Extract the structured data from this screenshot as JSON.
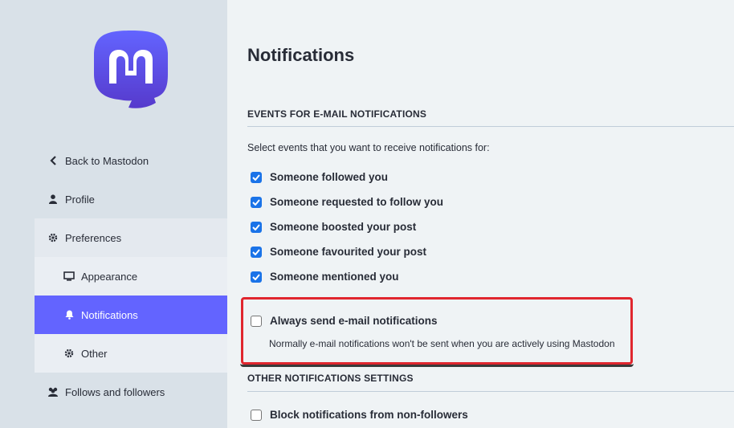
{
  "sidebar": {
    "logo": "mastodon-logo",
    "items": [
      {
        "label": "Back to Mastodon",
        "icon": "chevron-left-icon"
      },
      {
        "label": "Profile",
        "icon": "user-icon"
      },
      {
        "label": "Preferences",
        "icon": "gear-icon"
      },
      {
        "label": "Appearance",
        "icon": "desktop-icon"
      },
      {
        "label": "Notifications",
        "icon": "bell-icon",
        "active": true
      },
      {
        "label": "Other",
        "icon": "gear-icon"
      },
      {
        "label": "Follows and followers",
        "icon": "users-icon"
      }
    ]
  },
  "main": {
    "title": "Notifications",
    "email_section": {
      "heading": "EVENTS FOR E-MAIL NOTIFICATIONS",
      "hint": "Select events that you want to receive notifications for:",
      "options": [
        {
          "label": "Someone followed you",
          "checked": true
        },
        {
          "label": "Someone requested to follow you",
          "checked": true
        },
        {
          "label": "Someone boosted your post",
          "checked": true
        },
        {
          "label": "Someone favourited your post",
          "checked": true
        },
        {
          "label": "Someone mentioned you",
          "checked": true
        }
      ],
      "always_send": {
        "label": "Always send e-mail notifications",
        "checked": false,
        "description": "Normally e-mail notifications won't be sent when you are actively using Mastodon"
      }
    },
    "other_section": {
      "heading": "OTHER NOTIFICATIONS SETTINGS",
      "options": [
        {
          "label": "Block notifications from non-followers",
          "checked": false
        }
      ]
    }
  },
  "colors": {
    "accent": "#6364ff",
    "checkbox": "#1a73e8",
    "highlight": "#e0262e",
    "sidebar_bg": "#d9e1e8"
  }
}
